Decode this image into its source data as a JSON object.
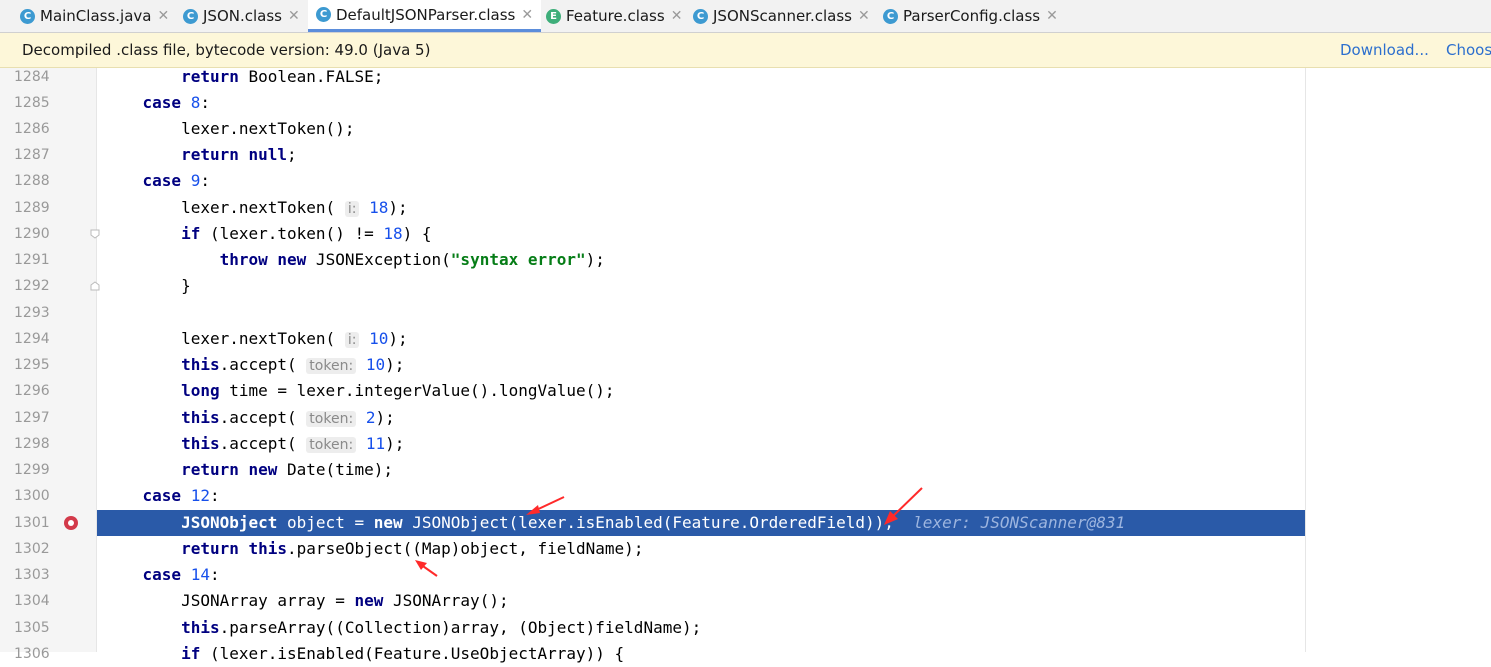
{
  "tabs": [
    {
      "label": "MainClass.java",
      "icon": "java-class-icon"
    },
    {
      "label": "JSON.class",
      "icon": "class-icon"
    },
    {
      "label": "DefaultJSONParser.class",
      "icon": "class-icon",
      "active": true
    },
    {
      "label": "Feature.class",
      "icon": "enum-icon"
    },
    {
      "label": "JSONScanner.class",
      "icon": "class-icon"
    },
    {
      "label": "ParserConfig.class",
      "icon": "class-icon"
    }
  ],
  "notification": {
    "message": "Decompiled .class file, bytecode version: 49.0 (Java 5)",
    "download_link": "Download...",
    "choose_link": "Choos"
  },
  "editor": {
    "line_numbers": [
      "1284",
      "1285",
      "1286",
      "1287",
      "1288",
      "1289",
      "1290",
      "1291",
      "1292",
      "1293",
      "1294",
      "1295",
      "1296",
      "1297",
      "1298",
      "1299",
      "1300",
      "1301",
      "1302",
      "1303",
      "1304",
      "1305",
      "1306"
    ],
    "current_line": "1301",
    "inline_debug_value": "lexer: JSONScanner@831",
    "hints": {
      "i": "i:",
      "token": "token:"
    },
    "strings": {
      "syntax_error": "\"syntax error\""
    }
  },
  "colors": {
    "selection": "#2a5aa8",
    "keyword": "#000080",
    "number": "#1750eb",
    "string": "#067d17",
    "breakpoint": "#d33a4a",
    "annotation_arrow": "#ff2a2a"
  }
}
